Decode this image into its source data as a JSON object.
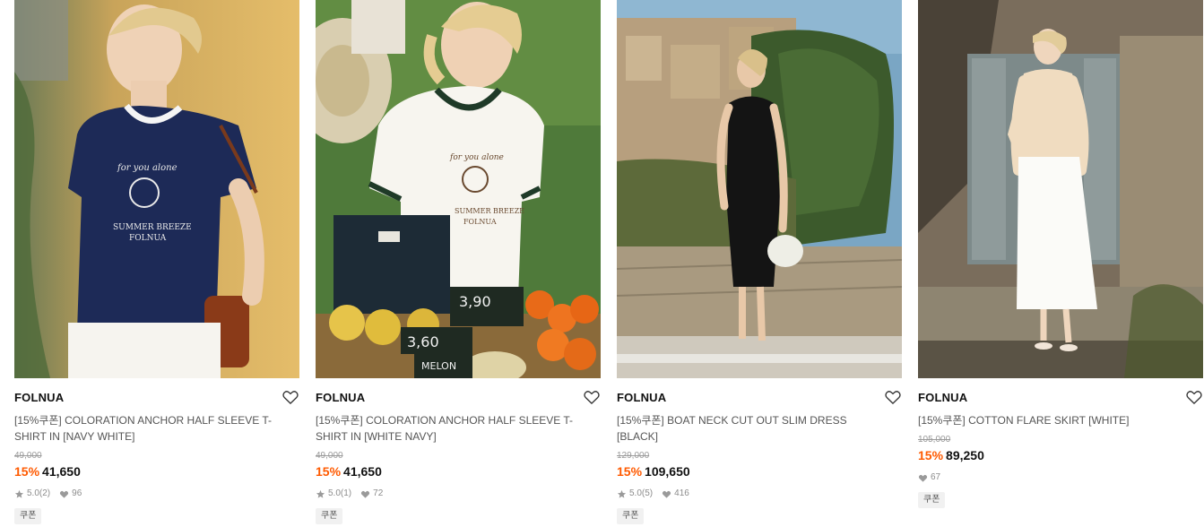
{
  "colors": {
    "discount": "#ff5a00",
    "original_price": "#9a9a9a",
    "meta": "#8c8c8c",
    "coupon_bg": "#f1f1f1"
  },
  "products": [
    {
      "brand": "FOLNUA",
      "name": "[15%쿠폰] COLORATION ANCHOR HALF SLEEVE T-SHIRT IN [NAVY WHITE]",
      "original_price": "49,000",
      "discount": "15%",
      "price": "41,650",
      "rating": "5.0",
      "reviews": "(2)",
      "likes": "96",
      "coupon": "쿠폰",
      "image": "model-navy-tee"
    },
    {
      "brand": "FOLNUA",
      "name": "[15%쿠폰] COLORATION ANCHOR HALF SLEEVE T-SHIRT IN [WHITE NAVY]",
      "original_price": "49,000",
      "discount": "15%",
      "price": "41,650",
      "rating": "5.0",
      "reviews": "(1)",
      "likes": "72",
      "coupon": "쿠폰",
      "image": "model-white-tee-market"
    },
    {
      "brand": "FOLNUA",
      "name": "[15%쿠폰] BOAT NECK CUT OUT SLIM DRESS [BLACK]",
      "original_price": "129,000",
      "discount": "15%",
      "price": "109,650",
      "rating": "5.0",
      "reviews": "(5)",
      "likes": "416",
      "coupon": "쿠폰",
      "image": "model-black-dress-village"
    },
    {
      "brand": "FOLNUA",
      "name": "[15%쿠폰] COTTON FLARE SKIRT [WHITE]",
      "original_price": "105,000",
      "discount": "15%",
      "price": "89,250",
      "likes": "67",
      "coupon": "쿠폰",
      "image": "model-white-skirt-doorway"
    }
  ]
}
